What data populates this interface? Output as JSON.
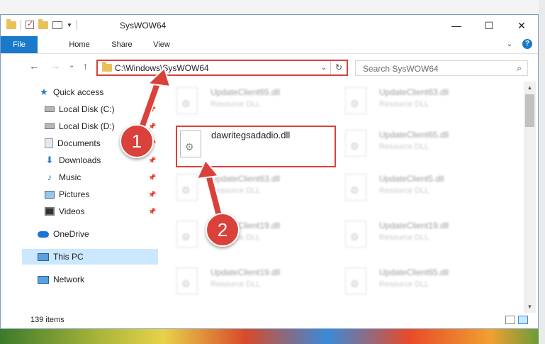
{
  "window": {
    "title": "SysWOW64"
  },
  "controls": {
    "minimize": "—",
    "maximize": "☐",
    "close": "✕"
  },
  "ribbon": {
    "tabs": [
      "File",
      "Home",
      "Share",
      "View"
    ],
    "chevron": "⌄",
    "help": "?"
  },
  "address": {
    "path": "C:\\Windows\\SysWOW64",
    "refresh": "↻",
    "dropdown": "⌄"
  },
  "search": {
    "placeholder": "Search SysWOW64",
    "icon": "search-icon"
  },
  "nav": {
    "back": "←",
    "forward": "→",
    "recent": "⌄",
    "up": "↑",
    "items": [
      {
        "label": "Quick access",
        "icon": "star-icon"
      },
      {
        "label": "Local Disk (C:)",
        "icon": "disk-icon"
      },
      {
        "label": "Local Disk (D:)",
        "icon": "disk-icon"
      },
      {
        "label": "Documents",
        "icon": "documents-icon"
      },
      {
        "label": "Downloads",
        "icon": "downloads-icon"
      },
      {
        "label": "Music",
        "icon": "music-icon"
      },
      {
        "label": "Pictures",
        "icon": "pictures-icon"
      },
      {
        "label": "Videos",
        "icon": "videos-icon"
      },
      {
        "label": "OneDrive",
        "icon": "cloud-icon"
      },
      {
        "label": "This PC",
        "icon": "pc-icon"
      },
      {
        "label": "Network",
        "icon": "network-icon"
      }
    ]
  },
  "files": [
    {
      "name": "UpdateClient65.dll",
      "type": "Resource DLL"
    },
    {
      "name": "UpdateClient63.dll",
      "type": "Resource DLL"
    },
    {
      "name": "dawritegsadadio.dll",
      "type": ""
    },
    {
      "name": "UpdateClient65.dll",
      "type": "Resource DLL"
    },
    {
      "name": "UpdateClient63.dll",
      "type": "Resource DLL"
    },
    {
      "name": "UpdateClient5.dll",
      "type": "Resource DLL"
    },
    {
      "name": "UpdateClient19.dll",
      "type": "Resource DLL"
    },
    {
      "name": "UpdateClient19.dll",
      "type": "Resource DLL"
    },
    {
      "name": "UpdateClient19.dll",
      "type": "Resource DLL"
    },
    {
      "name": "UpdateClient65.dll",
      "type": "Resource DLL"
    }
  ],
  "status": {
    "count": "139 items"
  },
  "annotations": {
    "step1": "1",
    "step2": "2",
    "color": "#d9413a"
  }
}
